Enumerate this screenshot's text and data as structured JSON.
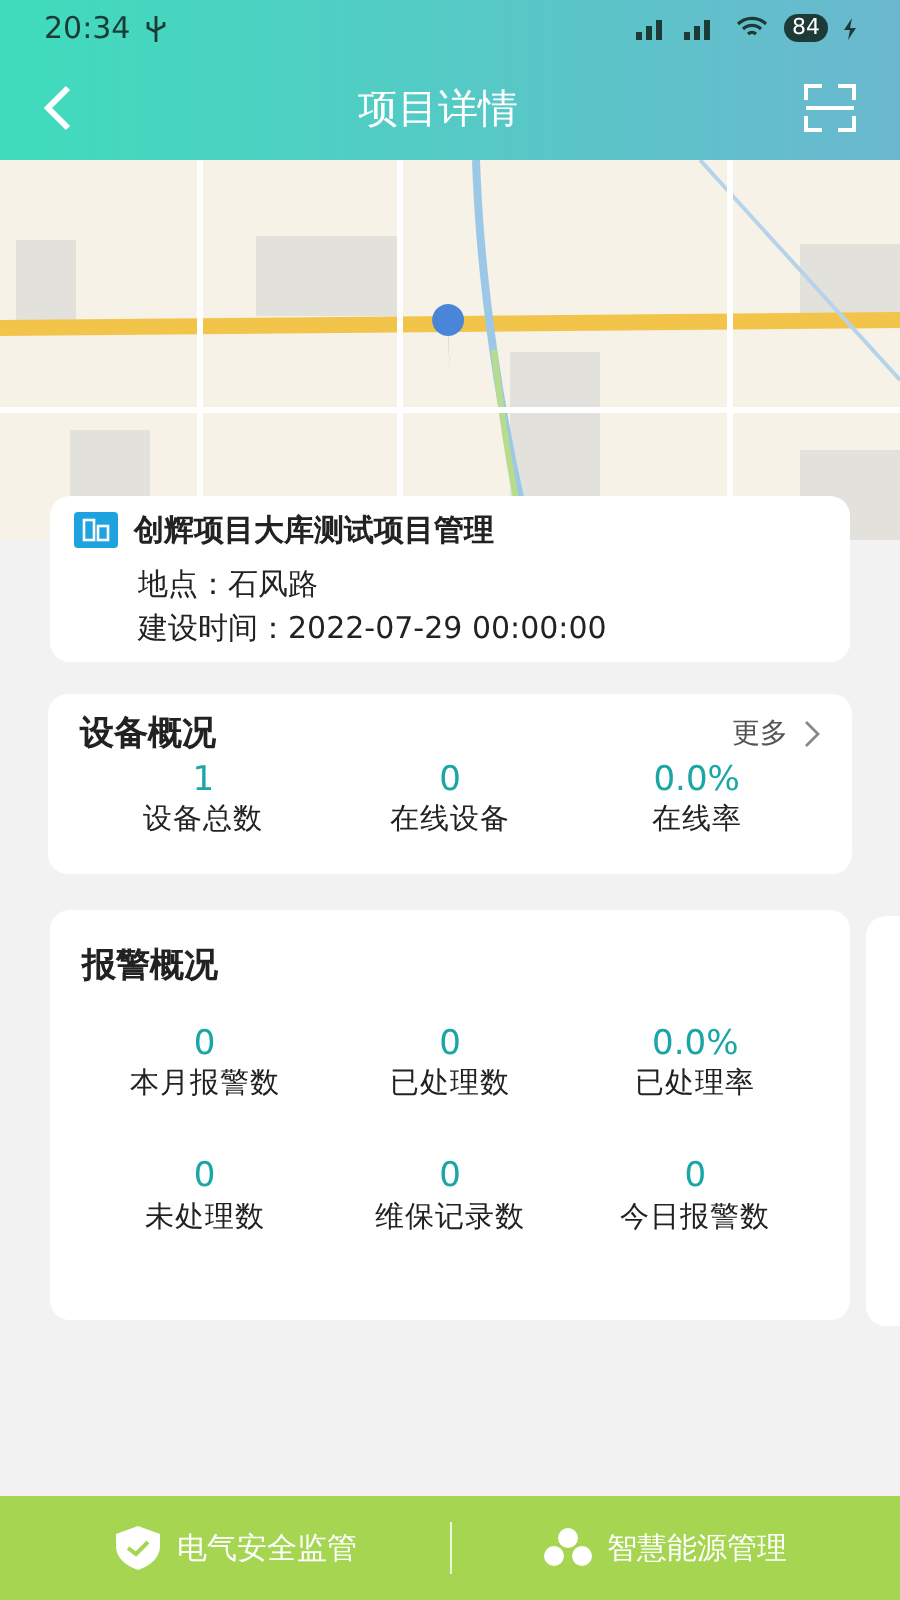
{
  "status_bar": {
    "time": "20:34",
    "battery": "84"
  },
  "header": {
    "title": "项目详情"
  },
  "project": {
    "name": "创辉项目大库测试项目管理",
    "location_label": "地点：",
    "location": "石风路",
    "time_label": "建设时间：",
    "time": "2022-07-29 00:00:00"
  },
  "device_overview": {
    "title": "设备概况",
    "more": "更多",
    "stats": [
      {
        "value": "1",
        "label": "设备总数"
      },
      {
        "value": "0",
        "label": "在线设备"
      },
      {
        "value": "0.0%",
        "label": "在线率"
      }
    ]
  },
  "alarm_overview": {
    "title": "报警概况",
    "stats": [
      {
        "value": "0",
        "label": "本月报警数"
      },
      {
        "value": "0",
        "label": "已处理数"
      },
      {
        "value": "0.0%",
        "label": "已处理率"
      },
      {
        "value": "0",
        "label": "未处理数"
      },
      {
        "value": "0",
        "label": "维保记录数"
      },
      {
        "value": "0",
        "label": "今日报警数"
      }
    ]
  },
  "bottom_nav": [
    {
      "label": "电气安全监管",
      "kind": "shield"
    },
    {
      "label": "智慧能源管理",
      "kind": "energy"
    }
  ]
}
